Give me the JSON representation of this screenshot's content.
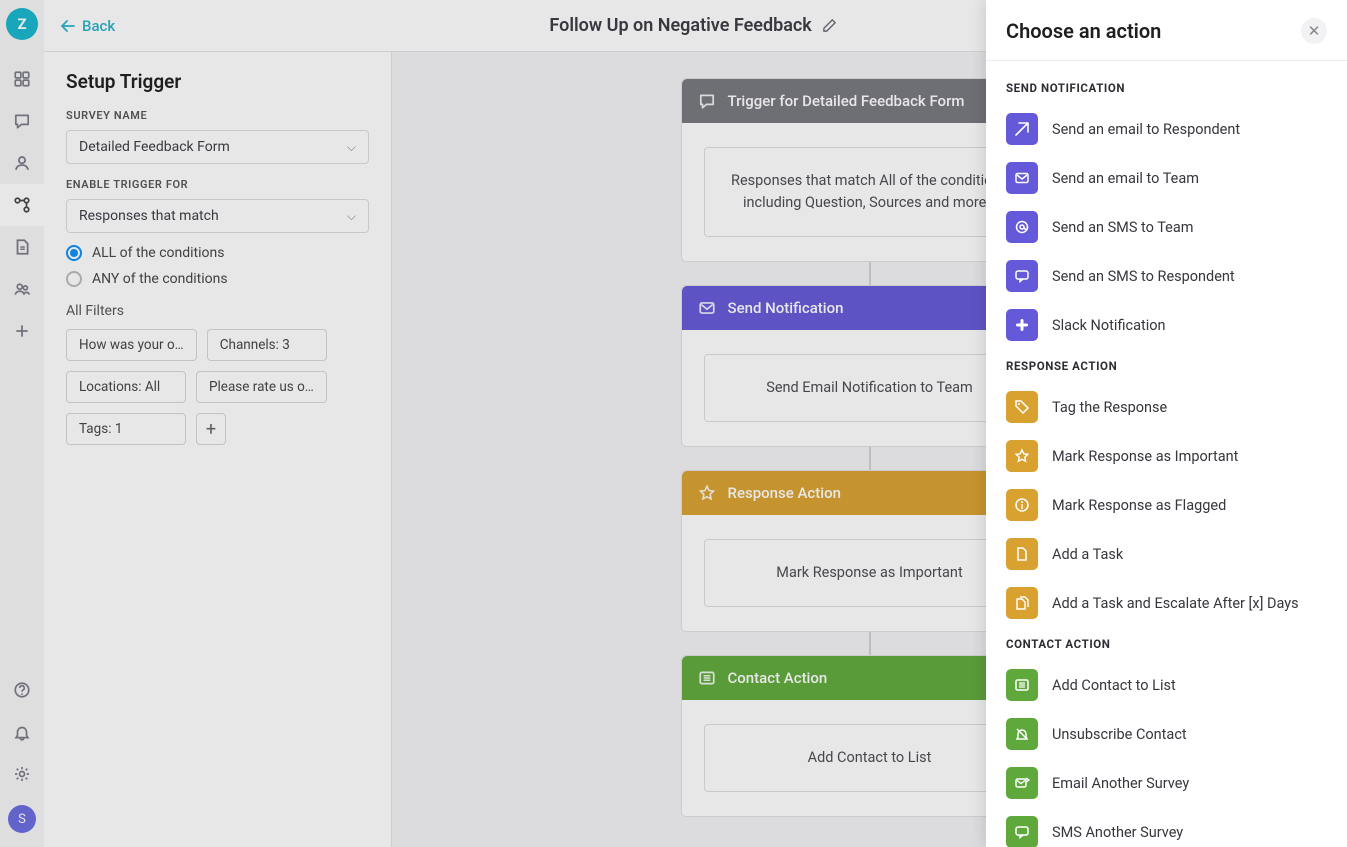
{
  "topbar": {
    "back_label": "Back",
    "page_title": "Follow Up on Negative Feedback"
  },
  "nav": {
    "avatar_letter": "S"
  },
  "sidebar": {
    "heading": "Setup Trigger",
    "survey_name_label": "SURVEY NAME",
    "survey_name_value": "Detailed Feedback Form",
    "enable_trigger_label": "ENABLE TRIGGER FOR",
    "enable_trigger_value": "Responses that match",
    "radio_all": "ALL of the conditions",
    "radio_any": "ANY of the conditions",
    "filters_label": "All Filters",
    "chips": [
      "How was your o…",
      "Channels: 3",
      "Locations: All",
      "Please rate us o…",
      "Tags: 1"
    ]
  },
  "canvas": {
    "trigger_title": "Trigger for Detailed Feedback Form",
    "trigger_body": "Responses that match All of the conditions including Question, Sources and more…",
    "notify_title": "Send Notification",
    "notify_body": "Send Email Notification to Team",
    "response_title": "Response Action",
    "response_body": "Mark Response as Important",
    "contact_title": "Contact Action",
    "contact_body": "Add Contact to List"
  },
  "drawer": {
    "title": "Choose an action",
    "groups": [
      {
        "label": "SEND NOTIFICATION",
        "color": "ic-purple",
        "items": [
          {
            "name": "Send an email to Respondent",
            "icon": "send"
          },
          {
            "name": "Send an email to Team",
            "icon": "mail"
          },
          {
            "name": "Send an SMS to Team",
            "icon": "at"
          },
          {
            "name": "Send an SMS to Respondent",
            "icon": "chat"
          },
          {
            "name": "Slack Notification",
            "icon": "slack"
          }
        ]
      },
      {
        "label": "RESPONSE ACTION",
        "color": "ic-amber",
        "items": [
          {
            "name": "Tag the Response",
            "icon": "tag"
          },
          {
            "name": "Mark Response as Important",
            "icon": "star"
          },
          {
            "name": "Mark Response as Flagged",
            "icon": "info"
          },
          {
            "name": "Add a Task",
            "icon": "doc"
          },
          {
            "name": "Add a Task and Escalate After [x] Days",
            "icon": "docs"
          }
        ]
      },
      {
        "label": "CONTACT ACTION",
        "color": "ic-green",
        "items": [
          {
            "name": "Add Contact to List",
            "icon": "list"
          },
          {
            "name": "Unsubscribe Contact",
            "icon": "belloff"
          },
          {
            "name": "Email Another Survey",
            "icon": "mailout"
          },
          {
            "name": "SMS Another Survey",
            "icon": "chat"
          }
        ]
      }
    ]
  }
}
